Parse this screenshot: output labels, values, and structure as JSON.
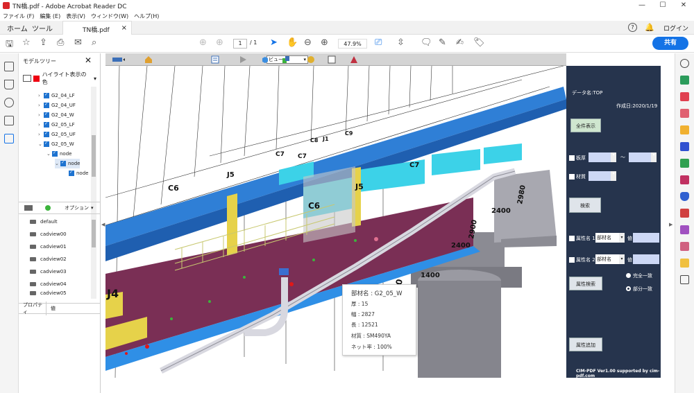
{
  "window": {
    "title": "TN橋.pdf - Adobe Acrobat Reader DC",
    "min": "—",
    "max": "☐",
    "close": "✕"
  },
  "menu": [
    "ファイル (F)",
    "編集 (E)",
    "表示(V)",
    "ウィンドウ(W)",
    "ヘルプ(H)"
  ],
  "tabs": {
    "home": "ホーム",
    "tools": "ツール",
    "doc": "TN橋.pdf",
    "doc_close": "×",
    "login": "ログイン",
    "help": "?"
  },
  "toolbar": {
    "page": "1",
    "page_count": "/ 1",
    "zoom": "47.9%",
    "share": "共有"
  },
  "tree": {
    "title": "モデルツリー",
    "highlight_label": "ハイライト表示の色",
    "items": [
      {
        "label": "G2_04_LF"
      },
      {
        "label": "G2_04_UF"
      },
      {
        "label": "G2_04_W"
      },
      {
        "label": "G2_05_LF"
      },
      {
        "label": "G2_05_UF"
      },
      {
        "label": "G2_05_W"
      },
      {
        "label": "node"
      },
      {
        "label": "node"
      },
      {
        "label": "node"
      }
    ],
    "options_label": "オプション",
    "views": [
      "default",
      "cadview00",
      "cadview01",
      "cadview02",
      "cadview03",
      "cadview04",
      "cadview05"
    ],
    "prop_col": "プロパティ",
    "value_col": "値"
  },
  "tb3d": {
    "view_select": "ビュー"
  },
  "cim": {
    "data_name": "データ名:TOP",
    "created": "作成日:2020/1/19",
    "show_all": "全件表示",
    "thickness": "板厚",
    "tilde": "～",
    "material": "材質",
    "search": "検索",
    "attr1": "属性名 1",
    "attr2": "属性名 2",
    "attr_sel1": "部材名",
    "attr_sel2": "部材名",
    "value_label1": "値",
    "value_label2": "値",
    "attr_search": "属性検索",
    "exact": "完全一致",
    "partial": "部分一致",
    "attr_add": "属性追加",
    "footer": "CIM-PDF Ver1.00 supported by cim-pdf.com"
  },
  "tooltip": {
    "name": "部材名 : G2_05_W",
    "thickness": "厚 : 15",
    "width": "幅 : 2827",
    "length": "長 : 12521",
    "material": "材質 : SM490YA",
    "net": "ネット率 : 100%"
  },
  "model_labels": {
    "c6a": "C6",
    "c6b": "C6",
    "j5a": "J5",
    "j5b": "J5",
    "c7a": "C7",
    "c7b": "C7",
    "c7c": "C7",
    "c8": "C8",
    "j1": "J1",
    "c9": "C9",
    "j4": "J4",
    "d1400": "1400",
    "d2400a": "2400",
    "d2400b": "2400",
    "d2900": "2900",
    "d2980": "2980",
    "d00": "00"
  },
  "colors": {
    "accent": "#1473e6",
    "panel": "#26344d",
    "girder_top": "#2f8fe6",
    "girder_web": "#7a2f55",
    "cyan": "#3cd2e8",
    "pier": "#8a8a92"
  }
}
